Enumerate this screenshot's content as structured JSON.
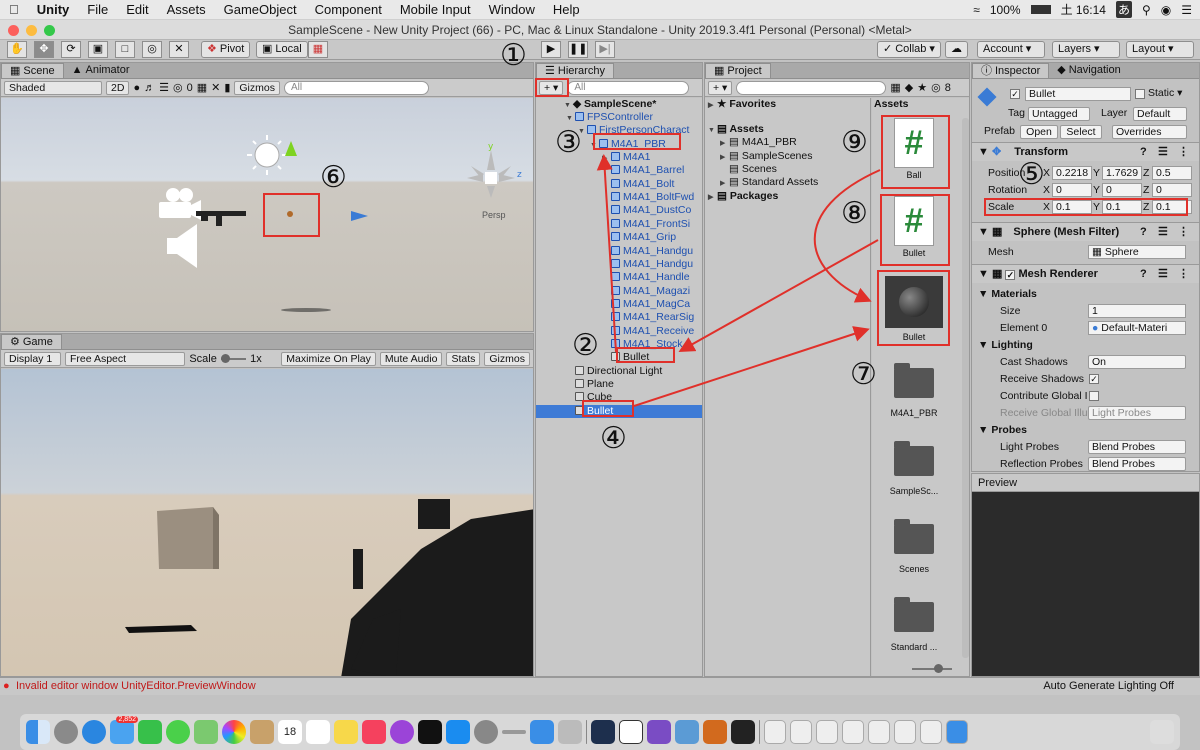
{
  "menubar": {
    "app": "Unity",
    "items": [
      "File",
      "Edit",
      "Assets",
      "GameObject",
      "Component",
      "Mobile Input",
      "Window",
      "Help"
    ],
    "battery": "100%",
    "time": "土 16:14",
    "input": "あ"
  },
  "window": {
    "title": "SampleScene - New Unity Project (66) - PC, Mac & Linux Standalone - Unity 2019.3.4f1 Personal (Personal) <Metal>"
  },
  "toolbar": {
    "pivot": "Pivot",
    "local": "Local",
    "collab": "Collab",
    "account": "Account",
    "layers": "Layers",
    "layout": "Layout"
  },
  "scene": {
    "tab": "Scene",
    "tab2": "Animator",
    "shading": "Shaded",
    "mode2d": "2D",
    "gizmos": "Gizmos",
    "search_placeholder": "All",
    "persp": "Persp",
    "layer_count": "0"
  },
  "game": {
    "tab": "Game",
    "display": "Display 1",
    "aspect": "Free Aspect",
    "scale_label": "Scale",
    "scale_value": "1x",
    "maximize": "Maximize On Play",
    "mute": "Mute Audio",
    "stats": "Stats",
    "gizmos": "Gizmos"
  },
  "hierarchy": {
    "tab": "Hierarchy",
    "search_placeholder": "All",
    "scene": "SampleScene*",
    "rows": [
      {
        "label": "FPSController",
        "indent": 1,
        "blue": true
      },
      {
        "label": "FirstPersonCharact",
        "indent": 2,
        "blue": true
      },
      {
        "label": "M4A1_PBR",
        "indent": 3,
        "blue": true
      },
      {
        "label": "M4A1",
        "indent": 4,
        "blue": true
      },
      {
        "label": "M4A1_Barrel",
        "indent": 4,
        "blue": true
      },
      {
        "label": "M4A1_Bolt",
        "indent": 4,
        "blue": true
      },
      {
        "label": "M4A1_BoltFwd",
        "indent": 4,
        "blue": true
      },
      {
        "label": "M4A1_DustCo",
        "indent": 4,
        "blue": true
      },
      {
        "label": "M4A1_FrontSi",
        "indent": 4,
        "blue": true
      },
      {
        "label": "M4A1_Grip",
        "indent": 4,
        "blue": true
      },
      {
        "label": "M4A1_Handgu",
        "indent": 4,
        "blue": true
      },
      {
        "label": "M4A1_Handgu",
        "indent": 4,
        "blue": true
      },
      {
        "label": "M4A1_Handle",
        "indent": 4,
        "blue": true
      },
      {
        "label": "M4A1_Magazi",
        "indent": 4,
        "blue": true
      },
      {
        "label": "M4A1_MagCa",
        "indent": 4,
        "blue": true
      },
      {
        "label": "M4A1_RearSig",
        "indent": 4,
        "blue": true
      },
      {
        "label": "M4A1_Receive",
        "indent": 4,
        "blue": true
      },
      {
        "label": "M4A1_Stock",
        "indent": 4,
        "blue": true
      },
      {
        "label": "Bullet",
        "indent": 4,
        "blue": false
      },
      {
        "label": "Directional Light",
        "indent": 1,
        "blue": false
      },
      {
        "label": "Plane",
        "indent": 1,
        "blue": false
      },
      {
        "label": "Cube",
        "indent": 1,
        "blue": false
      },
      {
        "label": "Bullet",
        "indent": 1,
        "blue": false,
        "selected": true
      }
    ]
  },
  "project": {
    "tab": "Project",
    "favorites": "Favorites",
    "assets": "Assets",
    "tree": [
      "M4A1_PBR",
      "SampleScenes",
      "Scenes",
      "Standard Assets"
    ],
    "packages": "Packages",
    "assets_header": "Assets",
    "count": "8",
    "tiles": [
      "Ball",
      "Bullet",
      "Bullet",
      "M4A1_PBR",
      "SampleSc...",
      "Scenes",
      "Standard ..."
    ],
    "script_glyph": "#"
  },
  "inspector": {
    "tab": "Inspector",
    "tab2": "Navigation",
    "name": "Bullet",
    "static": "Static",
    "tag_label": "Tag",
    "tag": "Untagged",
    "layer_label": "Layer",
    "layer": "Default",
    "prefab_label": "Prefab",
    "open": "Open",
    "select": "Select",
    "overrides": "Overrides",
    "transform": "Transform",
    "position_label": "Position",
    "position": {
      "x": "0.2218",
      "y": "1.7629",
      "z": "0.5"
    },
    "rotation_label": "Rotation",
    "rotation": {
      "x": "0",
      "y": "0",
      "z": "0"
    },
    "scale_label": "Scale",
    "scale": {
      "x": "0.1",
      "y": "0.1",
      "z": "0.1"
    },
    "axis_x": "X",
    "axis_y": "Y",
    "axis_z": "Z",
    "mesh_filter": "Sphere (Mesh Filter)",
    "mesh_label": "Mesh",
    "mesh": "Sphere",
    "mesh_renderer": "Mesh Renderer",
    "materials": "Materials",
    "size_label": "Size",
    "size": "1",
    "element0_label": "Element 0",
    "element0": "Default-Materi",
    "lighting": "Lighting",
    "cast_label": "Cast Shadows",
    "cast": "On",
    "receive_label": "Receive Shadows",
    "contribute_label": "Contribute Global I",
    "receive_gi_label": "Receive Global Illu",
    "receive_gi": "Light Probes",
    "probes": "Probes",
    "light_probes_label": "Light Probes",
    "light_probes": "Blend Probes",
    "reflection_label": "Reflection Probes",
    "reflection": "Blend Probes",
    "preview": "Preview"
  },
  "status": {
    "error": "Invalid editor window UnityEditor.PreviewWindow",
    "right": "Auto Generate Lighting Off"
  },
  "annotations": [
    "①",
    "②",
    "③",
    "④",
    "⑤",
    "⑥",
    "⑦",
    "⑧",
    "⑨"
  ],
  "colors": {
    "accent_red": "#e0302a",
    "selection": "#3e7bd6",
    "scene_sky": "#d9dfe8"
  },
  "dock": {
    "calendar_day": "18",
    "badge": "2,852"
  }
}
